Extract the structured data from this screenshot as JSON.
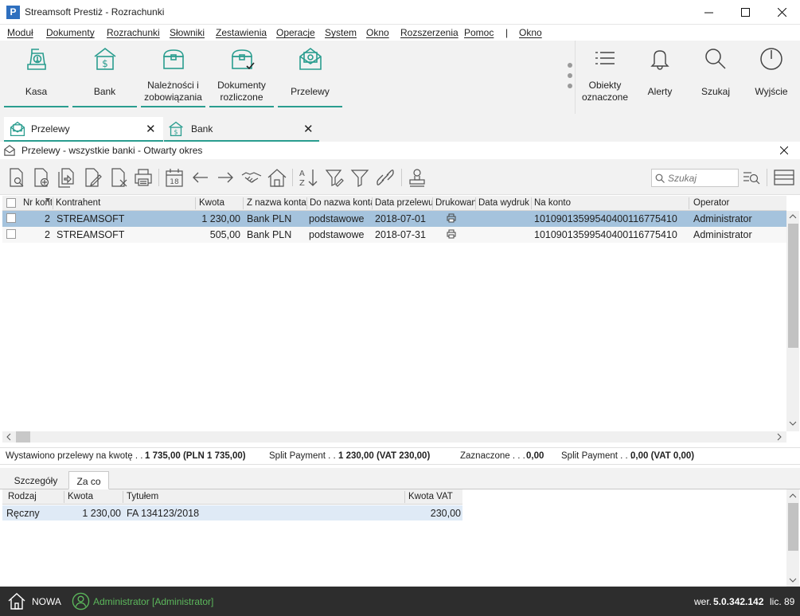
{
  "window": {
    "title": "Streamsoft Prestiż - Rozrachunki",
    "logo_letter": "P"
  },
  "menu": [
    "Moduł",
    "Dokumenty",
    "Rozrachunki",
    "Słowniki",
    "Zestawienia",
    "Operacje",
    "System",
    "Okno",
    "Rozszerzenia",
    "Pomoc",
    "|",
    "Okno"
  ],
  "ribbon": {
    "buttons": [
      {
        "label": "Kasa",
        "icon": "cash-register-icon"
      },
      {
        "label": "Bank",
        "icon": "bank-icon"
      },
      {
        "label": "Należności i zobowiązania",
        "label_line1": "Należności i",
        "label_line2": "zobowiązania",
        "icon": "chest-icon"
      },
      {
        "label": "Dokumenty rozliczone",
        "label_line1": "Dokumenty",
        "label_line2": "rozliczone",
        "icon": "chest-check-icon"
      },
      {
        "label": "Przelewy",
        "icon": "money-envelope-icon"
      }
    ],
    "right_buttons": [
      {
        "label_line1": "Obiekty",
        "label_line2": "oznaczone",
        "icon": "list-icon"
      },
      {
        "label": "Alerty",
        "icon": "bell-icon"
      },
      {
        "label": "Szukaj",
        "icon": "search-icon"
      },
      {
        "label": "Wyjście",
        "icon": "power-icon"
      }
    ]
  },
  "tabs": [
    {
      "label": "Przelewy",
      "active": true
    },
    {
      "label": "Bank",
      "active": false
    }
  ],
  "subwindow": {
    "title": "Przelewy - wszystkie banki - Otwarty okres"
  },
  "toolbar": {
    "search_placeholder": "Szukaj",
    "calendar_day": "18"
  },
  "grid": {
    "columns": [
      "Nr kont",
      "Kontrahent",
      "Kwota",
      "Z nazwa konta",
      "Do nazwa konta",
      "Data przelewu",
      "Drukowany",
      "Data wydruku",
      "Na konto",
      "Operator"
    ],
    "rows": [
      {
        "nr": "2",
        "kontrahent": "STREAMSOFT",
        "kwota": "1 230,00",
        "z_konta": "Bank PLN",
        "do_konta": "podstawowe",
        "data": "2018-07-01",
        "na_konto": "10109013599540400116775410",
        "operator": "Administrator",
        "selected": true
      },
      {
        "nr": "2",
        "kontrahent": "STREAMSOFT",
        "kwota": "505,00",
        "z_konta": "Bank PLN",
        "do_konta": "podstawowe",
        "data": "2018-07-31",
        "na_konto": "10109013599540400116775410",
        "operator": "Administrator",
        "selected": false
      }
    ]
  },
  "summary": {
    "issued_label": "Wystawiono przelewy na kwotę . . .",
    "issued_value": "1 735,00  (PLN 1 735,00)",
    "split_label": "Split Payment . . .",
    "split_value": "1 230,00  (VAT 230,00)",
    "selected_label": "Zaznaczone . . .",
    "selected_value": "0,00",
    "split2_label": "Split Payment . . .",
    "split2_value": "0,00  (VAT 0,00)"
  },
  "details": {
    "tabs": [
      "Szczegóły",
      "Za co"
    ],
    "active_tab": "Za co",
    "columns": [
      "Rodzaj",
      "Kwota",
      "Tytułem",
      "Kwota VAT"
    ],
    "rows": [
      {
        "rodzaj": "Ręczny",
        "kwota": "1 230,00",
        "tytulem": "FA 134123/2018",
        "kwota_vat": "230,00"
      }
    ]
  },
  "status": {
    "home_label": "NOWA",
    "user": "Administrator [Administrator]",
    "version_prefix": "wer.",
    "version": "5.0.342.142",
    "license": "lic. 89"
  },
  "colors": {
    "accent": "#2a9d8f",
    "selected_row": "#a5c3dd",
    "status_bg": "#2d2d2d",
    "user_green": "#5cb85c"
  }
}
